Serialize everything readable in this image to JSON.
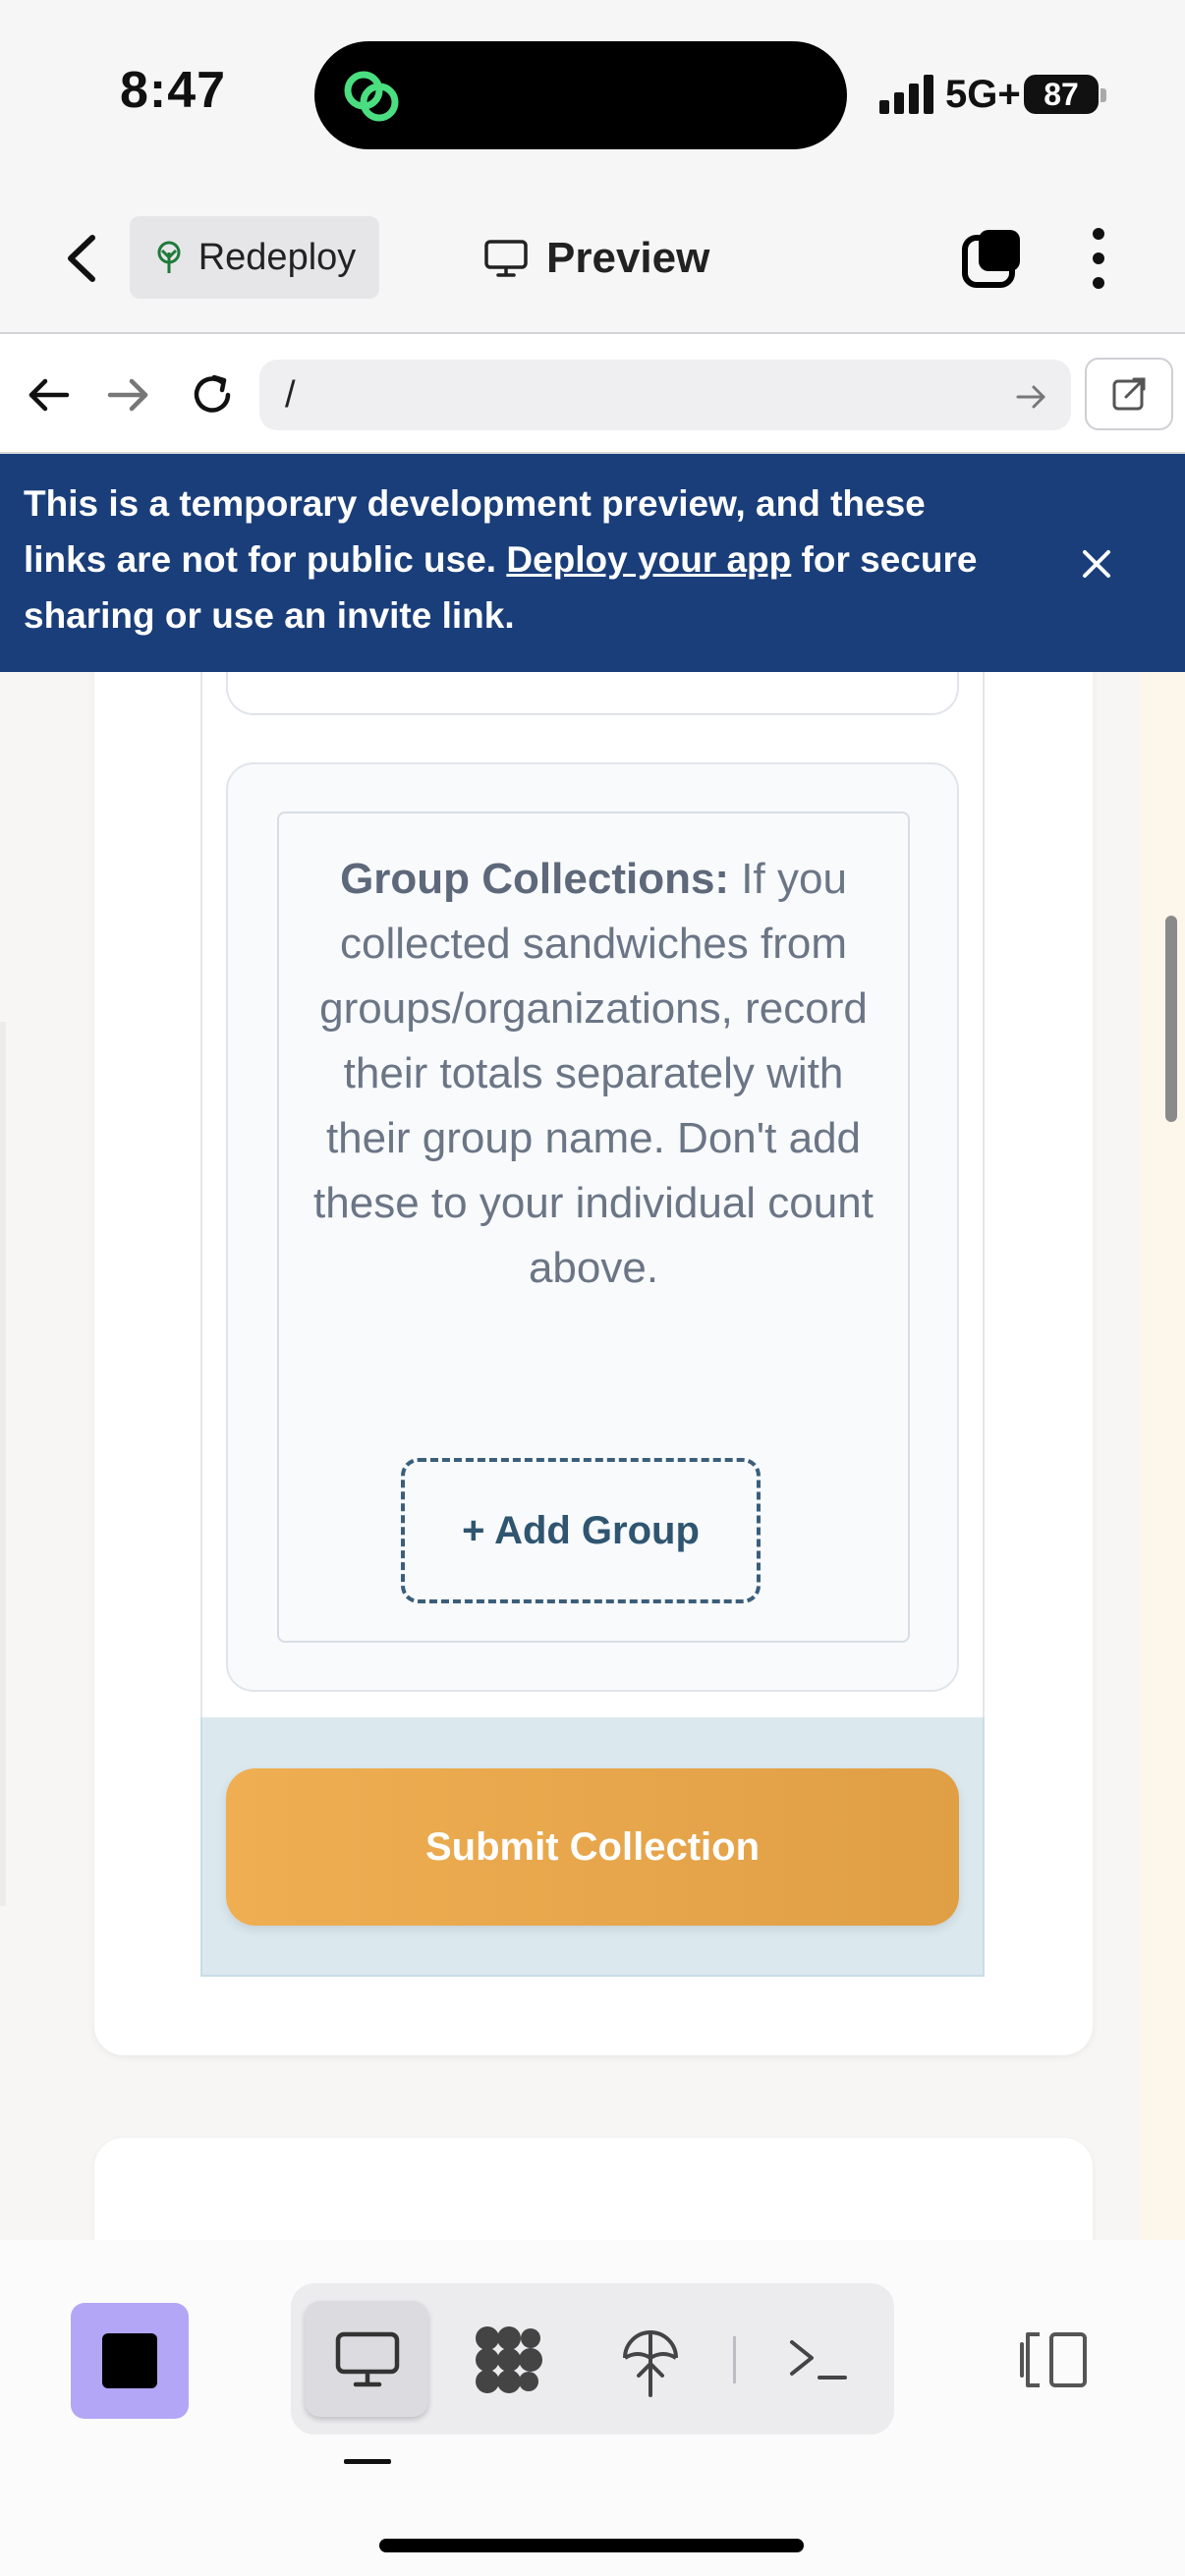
{
  "status_bar": {
    "time": "8:47",
    "network": "5G+",
    "battery": "87"
  },
  "app_header": {
    "redeploy_label": "Redeploy",
    "preview_label": "Preview"
  },
  "browser": {
    "url": "/"
  },
  "banner": {
    "text_before": "This is a temporary development preview, and these links are not for public use. ",
    "link_text": "Deploy your app",
    "text_after": " for secure sharing or use an invite link."
  },
  "group_section": {
    "info_label": "Group Collections:",
    "info_text": " If you collected sandwiches from groups/organizations, record their totals separately with their group name. Don't add these to your individual count above.",
    "add_group_label": "+ Add Group"
  },
  "submit_label": "Submit Collection",
  "icons": [
    "back-icon",
    "tree-icon",
    "monitor-icon",
    "tabs-icon",
    "more-icon",
    "arrow-left-icon",
    "arrow-right-icon",
    "reload-icon",
    "external-link-icon",
    "close-icon",
    "stop-icon",
    "desktop-icon",
    "workflow-icon",
    "deploy-icon",
    "terminal-icon",
    "split-view-icon"
  ],
  "colors": {
    "banner_bg": "#1a3e7a",
    "submit_bg": "#e8a74c",
    "stop_bg": "#b4a6f6",
    "submit_area_bg": "#dbe9ef"
  }
}
